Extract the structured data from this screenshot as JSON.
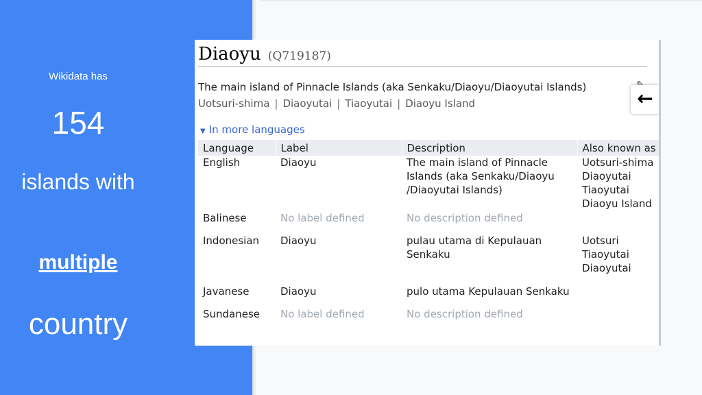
{
  "slide": {
    "intro": "Wikidata has",
    "count": "154",
    "line2": "islands with",
    "line3": "multiple",
    "line4": "country",
    "colors": {
      "panel": "#4285f4",
      "text": "#ffffff"
    }
  },
  "item": {
    "label": "Diaoyu",
    "id": "(Q719187)",
    "description": "The main island of Pinnacle Islands (aka Senkaku/Diaoyu/Diaoyutai Islands)",
    "aliases": [
      "Uotsuri-shima",
      "Diaoyutai",
      "Tiaoyutai",
      "Diaoyu Island"
    ],
    "alias_separator": "|",
    "edit_icon": "pencil-icon",
    "back_icon": "arrow-left-icon"
  },
  "languages_section": {
    "toggle_label": "In more languages",
    "headers": [
      "Language",
      "Label",
      "Description",
      "Also known as"
    ],
    "rows": [
      {
        "language": "English",
        "label": "Diaoyu",
        "description": "The main island of Pinnacle Islands (aka Senkaku/Diaoyu /Diaoyutai Islands)",
        "aliases": [
          "Uotsuri-shima",
          "Diaoyutai",
          "Tiaoyutai",
          "Diaoyu Island"
        ]
      },
      {
        "language": "Balinese",
        "label": "No label defined",
        "description": "No description defined",
        "aliases": []
      },
      {
        "language": "Indonesian",
        "label": "Diaoyu",
        "description": "pulau utama di Kepulauan Senkaku",
        "aliases": [
          "Uotsuri",
          "Tiaoyutai",
          "Diaoyutai"
        ]
      },
      {
        "language": "Javanese",
        "label": "Diaoyu",
        "description": "pulo utama Kepulauan Senkaku",
        "aliases": []
      },
      {
        "language": "Sundanese",
        "label": "No label defined",
        "description": "No description defined",
        "aliases": []
      }
    ]
  }
}
